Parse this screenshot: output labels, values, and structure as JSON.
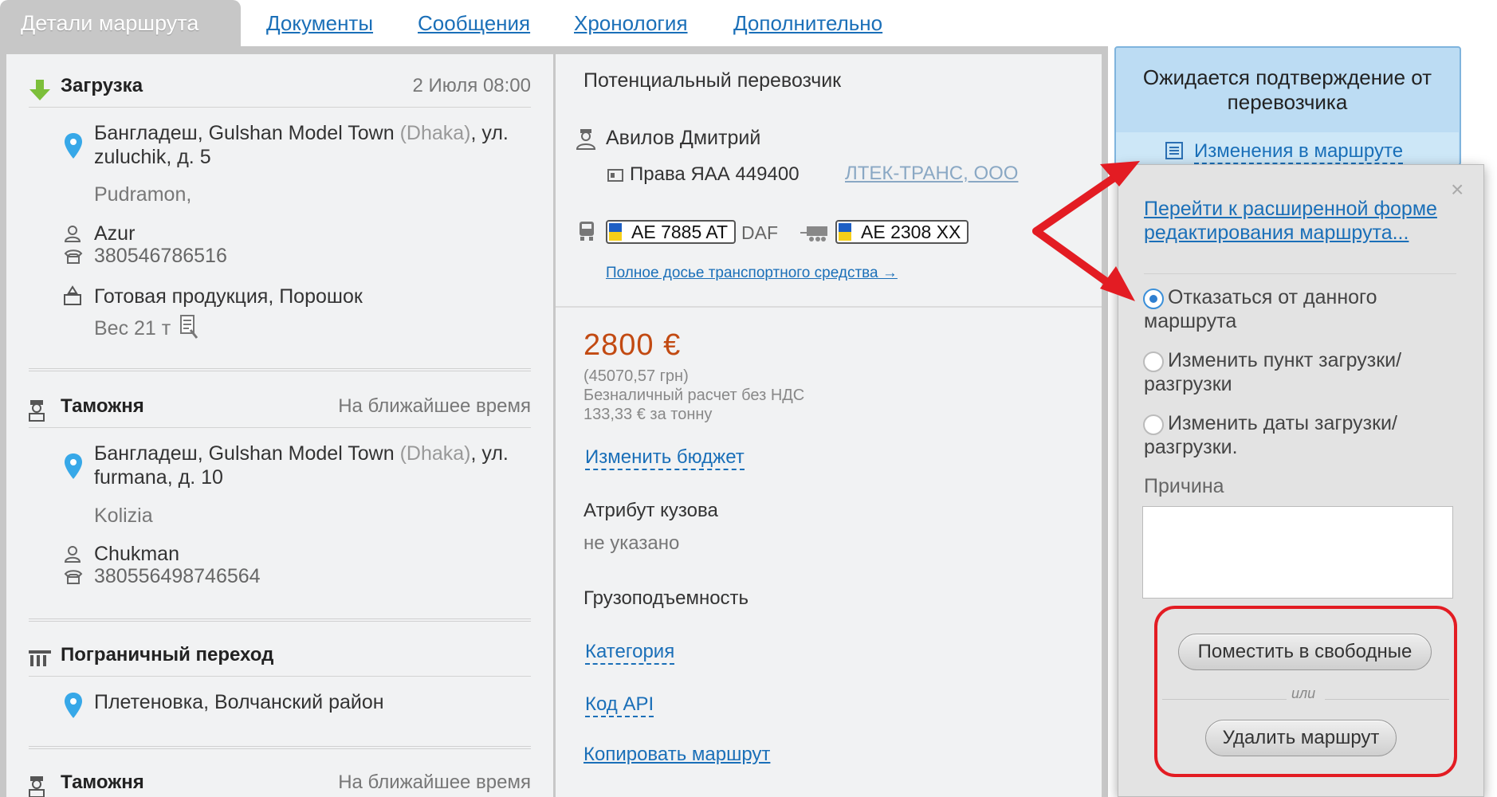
{
  "tabs": {
    "active": "Детали маршрута",
    "links": [
      "Документы",
      "Сообщения",
      "Хронология",
      "Дополнительно"
    ]
  },
  "route": {
    "loading": {
      "title": "Загрузка",
      "date": "2 Июля 08:00",
      "address_line1": "Бангладеш, Gulshan Model Town",
      "address_city": "(Dhaka)",
      "address_line1_end": ", ул.",
      "address_line2": "zuluchik, д. 5",
      "company": "Pudramon,",
      "contact_name": "Azur",
      "contact_phone": "380546786516",
      "cargo": "Готовая продукция, Порошок",
      "weight": "Вес 21 т"
    },
    "customs1": {
      "title": "Таможня",
      "meta": "На ближайшее время",
      "address_line1": "Бангладеш, Gulshan Model Town",
      "address_city": "(Dhaka)",
      "address_line1_end": ", ул.",
      "address_line2": "furmana, д. 10",
      "company": "Kolizia",
      "contact_name": "Chukman",
      "contact_phone": "380556498746564"
    },
    "border": {
      "title": "Пограничный переход",
      "address": "Плетеновка, Волчанский район"
    },
    "customs2": {
      "title": "Таможня",
      "meta": "На ближайшее время"
    }
  },
  "carrier": {
    "heading": "Потенциальный перевозчик",
    "driver_name": "Авилов Дмитрий",
    "license": "Права ЯАА 449400",
    "company_link": "ЛТЕК-ТРАНС, ООО",
    "truck_plate": "AE 7885 AT",
    "truck_brand": "DAF",
    "trailer_plate": "AE 2308 XX",
    "dossier_link": "Полное досье транспортного средства →"
  },
  "budget": {
    "price": "2800 €",
    "price_uah": "(45070,57 грн)",
    "payment": "Безналичный расчет без НДС",
    "per_ton": "133,33 € за тонну",
    "change_budget": "Изменить бюджет",
    "body_attr_label": "Атрибут кузова",
    "body_attr_value": "не указано",
    "capacity_label": "Грузоподъемность",
    "category_link": "Категория",
    "api_code_link": "Код API",
    "copy_route_link": "Копировать маршрут"
  },
  "status": {
    "title": "Ожидается подтверждение от перевозчика",
    "changes_link": "Изменения в маршруте"
  },
  "popup": {
    "close": "×",
    "advanced_link": "Перейти к расширенной форме редактирования маршрута...",
    "options": [
      {
        "label": "Отказаться от данного маршрута",
        "checked": true
      },
      {
        "label": "Изменить пункт загрузки/ разгрузки",
        "checked": false
      },
      {
        "label": "Изменить даты загрузки/ разгрузки.",
        "checked": false
      }
    ],
    "reason_label": "Причина",
    "reason_value": "",
    "free_button": "Поместить в свободные",
    "or_text": "или",
    "delete_button": "Удалить маршрут"
  },
  "colors": {
    "link": "#1a6fb8",
    "price": "#c24a12",
    "annotation_red": "#e31c23",
    "status_bg": "#bcdcf3"
  }
}
